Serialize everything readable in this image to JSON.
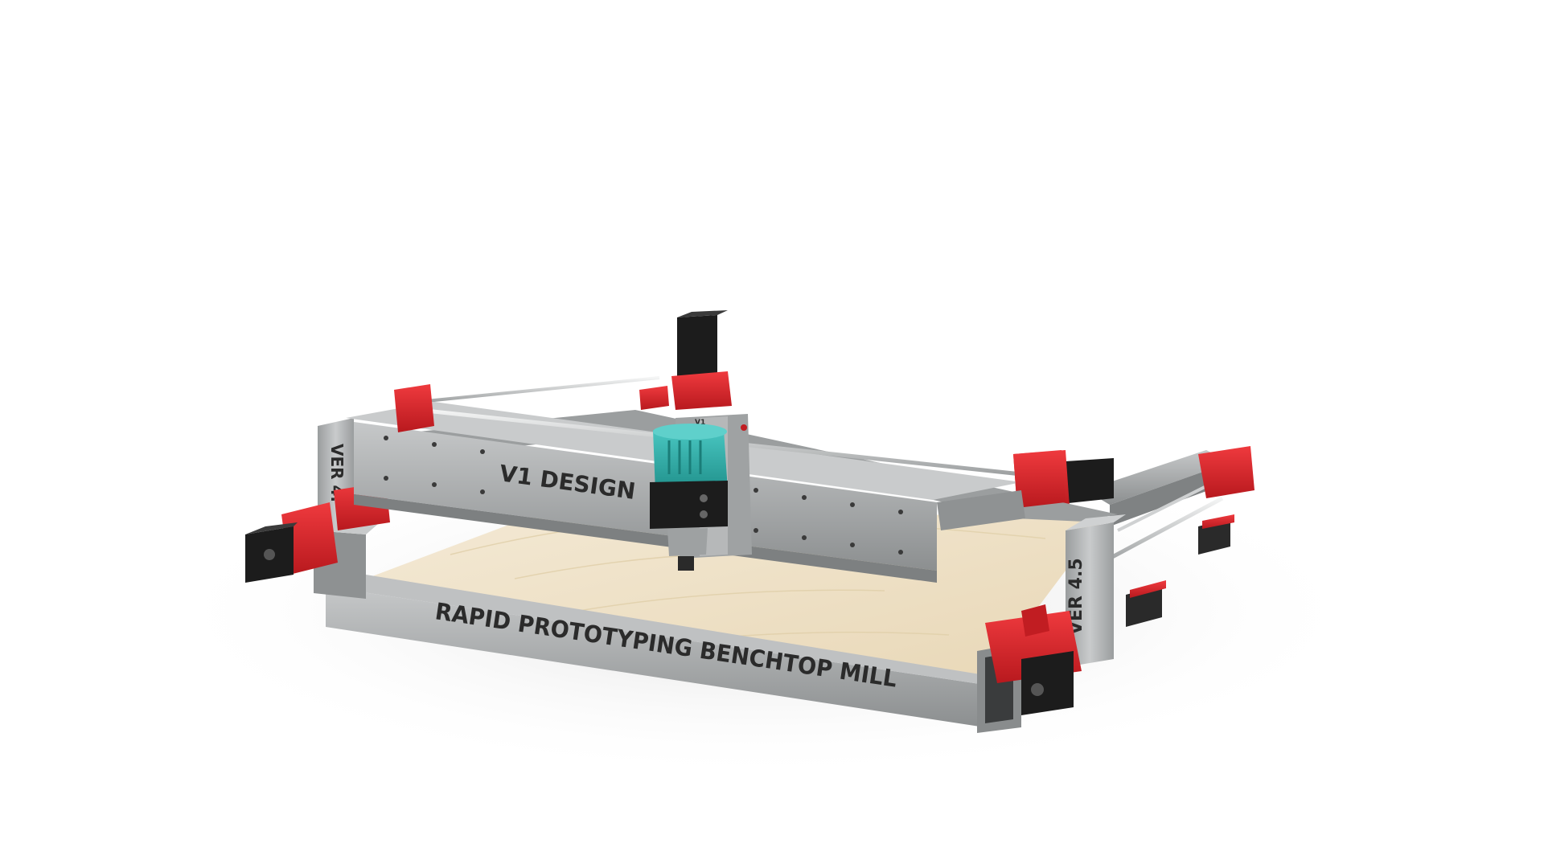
{
  "render": {
    "front_text": "RAPID PROTOTYPING BENCHTOP MILL",
    "gantry_logo": "V1 DESIGN",
    "left_version": "VER 4.",
    "right_version": "VER 4.5",
    "zmount_small": "V1"
  },
  "colors": {
    "background": "#ffffff",
    "floor_shadow": "#ececec",
    "frame_steel": "#a9abac",
    "frame_dark": "#7f8283",
    "printed_parts": "#e0262b",
    "printed_shade": "#b51a1f",
    "router_teal": "#2fb3ae",
    "motor_black": "#1c1c1c",
    "spoilboard": "#efe1c6",
    "rods": "#d8dadb"
  },
  "icons": {
    "left_motor": "stepper-motor-icon",
    "right_motor": "stepper-motor-icon",
    "z_motor": "stepper-motor-icon",
    "router": "router-spindle-icon"
  }
}
